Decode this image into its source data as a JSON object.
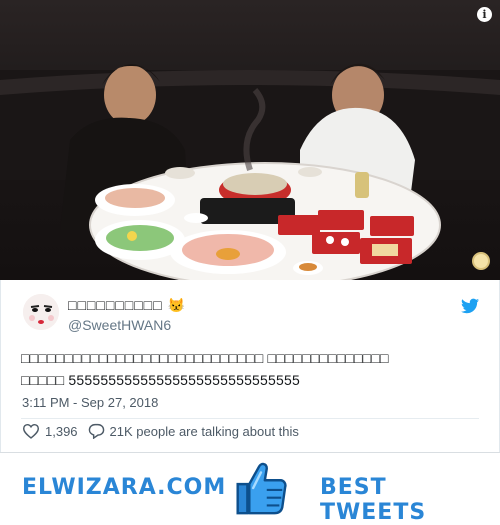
{
  "tweet": {
    "display_name": "□□□□□□□□□□",
    "display_emoji": "😾",
    "handle": "@SweetHWAN6",
    "text_line1": "□□□□□□□□□□□□□□□□□□□□□□□□□□□□ □□□□□□□□□□□□□□",
    "text_line2_prefix": "□□□□□ ",
    "text_line2_laugh": "55555555555555555555555555555",
    "time": "3:11 PM - Sep 27, 2018",
    "likes": "1,396",
    "conversation": "21K people are talking about this",
    "icons": {
      "like": "heart-icon",
      "reply": "speech-bubble-icon",
      "brand": "twitter-bird-icon",
      "info": "info-icon"
    }
  },
  "photo": {
    "info_symbol": "i"
  },
  "banner": {
    "site": "ELWIZARA.COM",
    "tagline": "BEST TWEETS",
    "icon": "thumbs-up-icon",
    "accent_color": "#2a86d6"
  }
}
